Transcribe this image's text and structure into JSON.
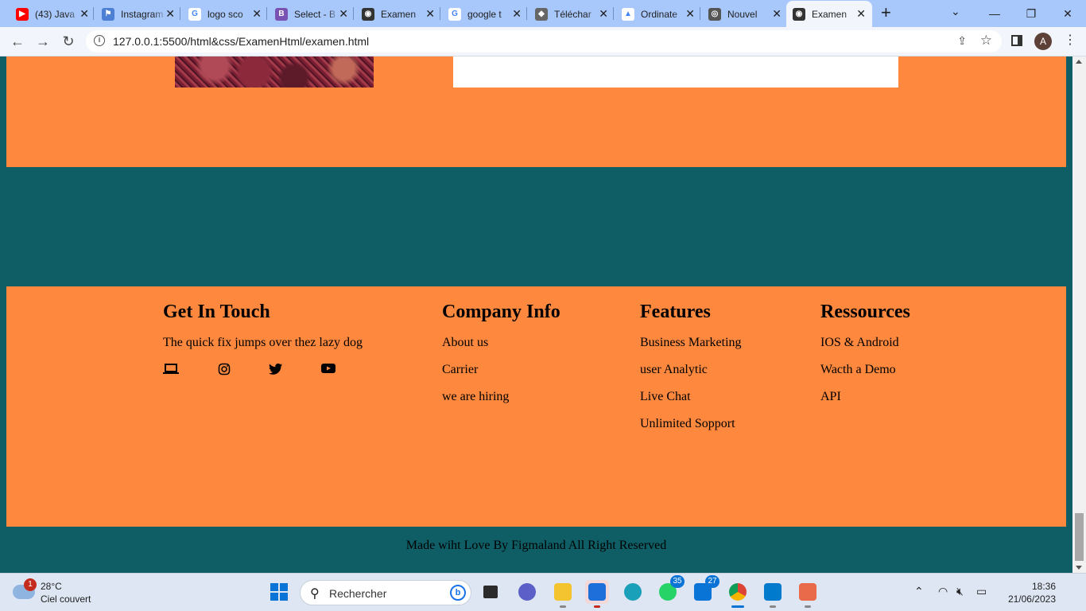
{
  "browser": {
    "tabs": [
      {
        "title": "(43) Java",
        "favicon": "youtube-icon",
        "color": "#ff0000",
        "glyph": "▶"
      },
      {
        "title": "Instagram",
        "favicon": "flag-icon",
        "color": "#4d7fd4",
        "glyph": "⚑"
      },
      {
        "title": "logo sco",
        "favicon": "google-icon",
        "color": "#ffffff",
        "glyph": "G"
      },
      {
        "title": "Select - B",
        "favicon": "bootstrap-icon",
        "color": "#7952b3",
        "glyph": "B"
      },
      {
        "title": "Examen",
        "favicon": "globe-icon",
        "color": "#333333",
        "glyph": "◉"
      },
      {
        "title": "google t",
        "favicon": "google-icon",
        "color": "#ffffff",
        "glyph": "G"
      },
      {
        "title": "Téléchar",
        "favicon": "cap-icon",
        "color": "#666666",
        "glyph": "◆"
      },
      {
        "title": "Ordinate",
        "favicon": "drive-icon",
        "color": "#ffffff",
        "glyph": "▲"
      },
      {
        "title": "Nouvel",
        "favicon": "chrome-icon",
        "color": "#555555",
        "glyph": "◎"
      },
      {
        "title": "Examen",
        "favicon": "globe-icon",
        "color": "#333333",
        "glyph": "◉",
        "active": true
      }
    ],
    "url": "127.0.0.1:5500/html&css/ExamenHtml/examen.html",
    "profile_initial": "A"
  },
  "page": {
    "footer": {
      "get_in_touch": {
        "title": "Get In Touch",
        "text": "The quick fix jumps over thez lazy dog",
        "socials": [
          "laptop-icon",
          "instagram-icon",
          "twitter-icon",
          "youtube-icon"
        ]
      },
      "company_info": {
        "title": "Company Info",
        "links": [
          "About us",
          "Carrier",
          "we are hiring"
        ]
      },
      "features": {
        "title": "Features",
        "links": [
          "Business Marketing",
          "user Analytic",
          "Live Chat",
          "Unlimited Sopport"
        ]
      },
      "ressources": {
        "title": "Ressources",
        "links": [
          "IOS & Android",
          "Wacth a Demo",
          "API"
        ]
      }
    },
    "copyright": "Made wiht Love By Figmaland All Right Reserved",
    "colors": {
      "orange": "#fd883e",
      "teal": "#0f5e66"
    }
  },
  "taskbar": {
    "weather": {
      "badge": "1",
      "temp": "28°C",
      "condition": "Ciel couvert"
    },
    "search_placeholder": "Rechercher",
    "badges": {
      "teams": "35",
      "whatsapp": "",
      "mail": "27"
    },
    "clock": {
      "time": "18:36",
      "date": "21/06/2023"
    }
  }
}
